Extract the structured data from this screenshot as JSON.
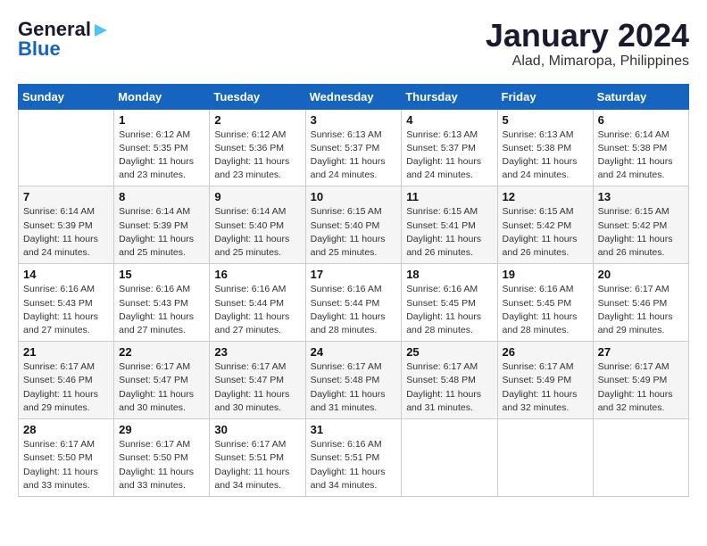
{
  "header": {
    "logo_line1": "General",
    "logo_line2": "Blue",
    "month": "January 2024",
    "location": "Alad, Mimaropa, Philippines"
  },
  "weekdays": [
    "Sunday",
    "Monday",
    "Tuesday",
    "Wednesday",
    "Thursday",
    "Friday",
    "Saturday"
  ],
  "weeks": [
    [
      {
        "day": "",
        "info": ""
      },
      {
        "day": "1",
        "info": "Sunrise: 6:12 AM\nSunset: 5:35 PM\nDaylight: 11 hours\nand 23 minutes."
      },
      {
        "day": "2",
        "info": "Sunrise: 6:12 AM\nSunset: 5:36 PM\nDaylight: 11 hours\nand 23 minutes."
      },
      {
        "day": "3",
        "info": "Sunrise: 6:13 AM\nSunset: 5:37 PM\nDaylight: 11 hours\nand 24 minutes."
      },
      {
        "day": "4",
        "info": "Sunrise: 6:13 AM\nSunset: 5:37 PM\nDaylight: 11 hours\nand 24 minutes."
      },
      {
        "day": "5",
        "info": "Sunrise: 6:13 AM\nSunset: 5:38 PM\nDaylight: 11 hours\nand 24 minutes."
      },
      {
        "day": "6",
        "info": "Sunrise: 6:14 AM\nSunset: 5:38 PM\nDaylight: 11 hours\nand 24 minutes."
      }
    ],
    [
      {
        "day": "7",
        "info": "Sunrise: 6:14 AM\nSunset: 5:39 PM\nDaylight: 11 hours\nand 24 minutes."
      },
      {
        "day": "8",
        "info": "Sunrise: 6:14 AM\nSunset: 5:39 PM\nDaylight: 11 hours\nand 25 minutes."
      },
      {
        "day": "9",
        "info": "Sunrise: 6:14 AM\nSunset: 5:40 PM\nDaylight: 11 hours\nand 25 minutes."
      },
      {
        "day": "10",
        "info": "Sunrise: 6:15 AM\nSunset: 5:40 PM\nDaylight: 11 hours\nand 25 minutes."
      },
      {
        "day": "11",
        "info": "Sunrise: 6:15 AM\nSunset: 5:41 PM\nDaylight: 11 hours\nand 26 minutes."
      },
      {
        "day": "12",
        "info": "Sunrise: 6:15 AM\nSunset: 5:42 PM\nDaylight: 11 hours\nand 26 minutes."
      },
      {
        "day": "13",
        "info": "Sunrise: 6:15 AM\nSunset: 5:42 PM\nDaylight: 11 hours\nand 26 minutes."
      }
    ],
    [
      {
        "day": "14",
        "info": "Sunrise: 6:16 AM\nSunset: 5:43 PM\nDaylight: 11 hours\nand 27 minutes."
      },
      {
        "day": "15",
        "info": "Sunrise: 6:16 AM\nSunset: 5:43 PM\nDaylight: 11 hours\nand 27 minutes."
      },
      {
        "day": "16",
        "info": "Sunrise: 6:16 AM\nSunset: 5:44 PM\nDaylight: 11 hours\nand 27 minutes."
      },
      {
        "day": "17",
        "info": "Sunrise: 6:16 AM\nSunset: 5:44 PM\nDaylight: 11 hours\nand 28 minutes."
      },
      {
        "day": "18",
        "info": "Sunrise: 6:16 AM\nSunset: 5:45 PM\nDaylight: 11 hours\nand 28 minutes."
      },
      {
        "day": "19",
        "info": "Sunrise: 6:16 AM\nSunset: 5:45 PM\nDaylight: 11 hours\nand 28 minutes."
      },
      {
        "day": "20",
        "info": "Sunrise: 6:17 AM\nSunset: 5:46 PM\nDaylight: 11 hours\nand 29 minutes."
      }
    ],
    [
      {
        "day": "21",
        "info": "Sunrise: 6:17 AM\nSunset: 5:46 PM\nDaylight: 11 hours\nand 29 minutes."
      },
      {
        "day": "22",
        "info": "Sunrise: 6:17 AM\nSunset: 5:47 PM\nDaylight: 11 hours\nand 30 minutes."
      },
      {
        "day": "23",
        "info": "Sunrise: 6:17 AM\nSunset: 5:47 PM\nDaylight: 11 hours\nand 30 minutes."
      },
      {
        "day": "24",
        "info": "Sunrise: 6:17 AM\nSunset: 5:48 PM\nDaylight: 11 hours\nand 31 minutes."
      },
      {
        "day": "25",
        "info": "Sunrise: 6:17 AM\nSunset: 5:48 PM\nDaylight: 11 hours\nand 31 minutes."
      },
      {
        "day": "26",
        "info": "Sunrise: 6:17 AM\nSunset: 5:49 PM\nDaylight: 11 hours\nand 32 minutes."
      },
      {
        "day": "27",
        "info": "Sunrise: 6:17 AM\nSunset: 5:49 PM\nDaylight: 11 hours\nand 32 minutes."
      }
    ],
    [
      {
        "day": "28",
        "info": "Sunrise: 6:17 AM\nSunset: 5:50 PM\nDaylight: 11 hours\nand 33 minutes."
      },
      {
        "day": "29",
        "info": "Sunrise: 6:17 AM\nSunset: 5:50 PM\nDaylight: 11 hours\nand 33 minutes."
      },
      {
        "day": "30",
        "info": "Sunrise: 6:17 AM\nSunset: 5:51 PM\nDaylight: 11 hours\nand 34 minutes."
      },
      {
        "day": "31",
        "info": "Sunrise: 6:16 AM\nSunset: 5:51 PM\nDaylight: 11 hours\nand 34 minutes."
      },
      {
        "day": "",
        "info": ""
      },
      {
        "day": "",
        "info": ""
      },
      {
        "day": "",
        "info": ""
      }
    ]
  ]
}
